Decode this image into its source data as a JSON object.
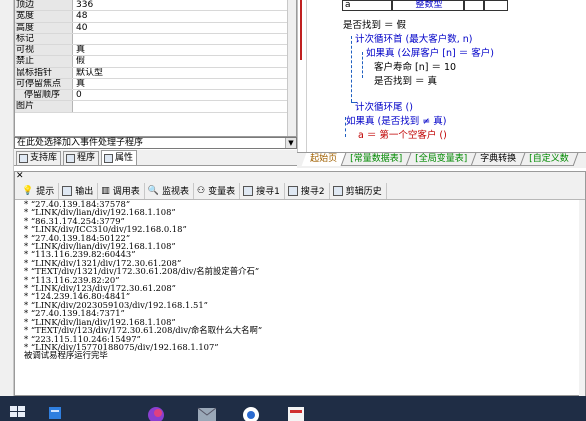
{
  "properties": [
    {
      "name": "顶边",
      "value": "336",
      "indent": false
    },
    {
      "name": "宽度",
      "value": "48",
      "indent": false
    },
    {
      "name": "高度",
      "value": "40",
      "indent": false
    },
    {
      "name": "标记",
      "value": "",
      "indent": false
    },
    {
      "name": "可视",
      "value": "真",
      "indent": false
    },
    {
      "name": "禁止",
      "value": "假",
      "indent": false
    },
    {
      "name": "鼠标指针",
      "value": "默认型",
      "indent": false
    },
    {
      "name": "可停留焦点",
      "value": "真",
      "indent": false
    },
    {
      "name": "停留顺序",
      "value": "0",
      "indent": true
    },
    {
      "name": "图片",
      "value": "",
      "indent": false
    }
  ],
  "event_select": "在此处选择加入事件处理子程序",
  "left_tabs": [
    {
      "label": "支持库",
      "icon": "library-icon",
      "active": false
    },
    {
      "label": "程序",
      "icon": "program-icon",
      "active": false
    },
    {
      "label": "属性",
      "icon": "property-icon",
      "active": true
    }
  ],
  "code": {
    "header_cell_a": "a",
    "header_cell_type": "整数型",
    "lines": [
      "是否找到 ＝ 假",
      "计次循环首 (最大客户数, n)",
      "如果真 (公屏客户 [n] ＝ 客户)",
      "客户寿命 [n] ＝ 10",
      "是否找到 ＝ 真",
      "计次循环尾 ()",
      "如果真 (是否找到 ≠ 真)",
      "a ＝ 第一个空客户 ()"
    ]
  },
  "code_tabs": [
    {
      "label": "起始页",
      "active": true
    },
    {
      "label": "[常量数据表]",
      "active": false
    },
    {
      "label": "[全局变量表]",
      "active": false
    },
    {
      "label": "字典转换",
      "active": false
    },
    {
      "label": "[自定义数",
      "active": false
    }
  ],
  "output_tabs": [
    {
      "label": "提示",
      "icon": "lightbulb-icon"
    },
    {
      "label": "输出",
      "icon": "output-icon"
    },
    {
      "label": "调用表",
      "icon": "call-table-icon"
    },
    {
      "label": "监视表",
      "icon": "watch-icon"
    },
    {
      "label": "变量表",
      "icon": "variable-icon"
    },
    {
      "label": "搜寻1",
      "icon": "search1-icon"
    },
    {
      "label": "搜寻2",
      "icon": "search2-icon"
    },
    {
      "label": "剪辑历史",
      "icon": "clip-history-icon"
    }
  ],
  "output_lines": [
    "* “27.40.139.184:37578”",
    "* “LINK/div/lian/div/192.168.1.108”",
    "* “86.31.174.254:3779”",
    "* “LINK/div/ICC310/div/192.168.0.18”",
    "* “27.40.139.184:50122”",
    "* “LINK/div/lian/div/192.168.1.108”",
    "* “113.116.239.82:60443”",
    "* “LINK/div/1321/div/172.30.61.208”",
    "* “TEXT/div/1321/div/172.30.61.208/div/名前設定普介石”",
    "* “113.116.239.82:20”",
    "* “LINK/div/123/div/172.30.61.208”",
    "* “124.239.146.80:4841”",
    "* “LINK/div/2023059103/div/192.168.1.51”",
    "* “27.40.139.184:7371”",
    "* “LINK/div/lian/div/192.168.1.108”",
    "* “TEXT/div/123/div/172.30.61.208/div/命名取什么大名啊”",
    "* “223.115.110.246:15497”",
    "* “LINK/div/15770188075/div/192.168.1.107”",
    "被调试易程序运行完毕"
  ]
}
